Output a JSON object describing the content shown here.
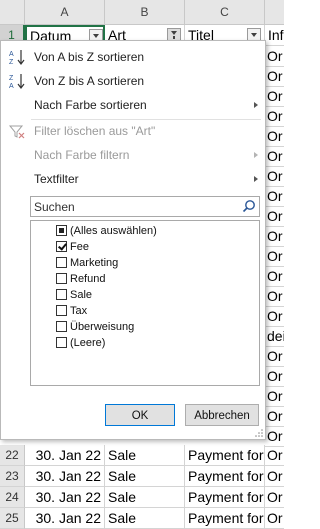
{
  "sheet": {
    "columns": [
      "A",
      "B",
      "C",
      "Inf"
    ],
    "header_row_number": "1",
    "headers": [
      "Datum",
      "Art",
      "Titel",
      "Inf"
    ],
    "right_column_cells": [
      "Or",
      "Or",
      "Or",
      "Or",
      "Or",
      "Or",
      "Or",
      "Or",
      "Or",
      "Or",
      "Or",
      "Or",
      "Or",
      "Or",
      "dei",
      "Or",
      "Or",
      "Or",
      "Or",
      "Or"
    ],
    "rows": [
      {
        "num": "22",
        "date": "30. Jan 22",
        "art": "Sale",
        "titel": "Payment for",
        "info": "Or"
      },
      {
        "num": "23",
        "date": "30. Jan 22",
        "art": "Sale",
        "titel": "Payment for",
        "info": "Or"
      },
      {
        "num": "24",
        "date": "30. Jan 22",
        "art": "Sale",
        "titel": "Payment for",
        "info": "Or"
      },
      {
        "num": "25",
        "date": "30. Jan 22",
        "art": "Sale",
        "titel": "Payment for",
        "info": "Or"
      }
    ]
  },
  "menu": {
    "sort_az": "Von A bis Z sortieren",
    "sort_za": "Von Z bis A sortieren",
    "sort_color": "Nach Farbe sortieren",
    "clear_filter": "Filter löschen aus \"Art\"",
    "filter_color": "Nach Farbe filtern",
    "text_filter": "Textfilter",
    "search_placeholder": "Suchen",
    "items": [
      {
        "label": "(Alles auswählen)",
        "state": "indeterminate"
      },
      {
        "label": "Fee",
        "state": "checked"
      },
      {
        "label": "Marketing",
        "state": "unchecked"
      },
      {
        "label": "Refund",
        "state": "unchecked"
      },
      {
        "label": "Sale",
        "state": "unchecked"
      },
      {
        "label": "Tax",
        "state": "unchecked"
      },
      {
        "label": "Überweisung",
        "state": "unchecked"
      },
      {
        "label": "(Leere)",
        "state": "unchecked"
      }
    ],
    "ok_label": "OK",
    "cancel_label": "Abbrechen"
  },
  "colors": {
    "excel_green": "#217346",
    "ok_border": "#0078d7"
  }
}
